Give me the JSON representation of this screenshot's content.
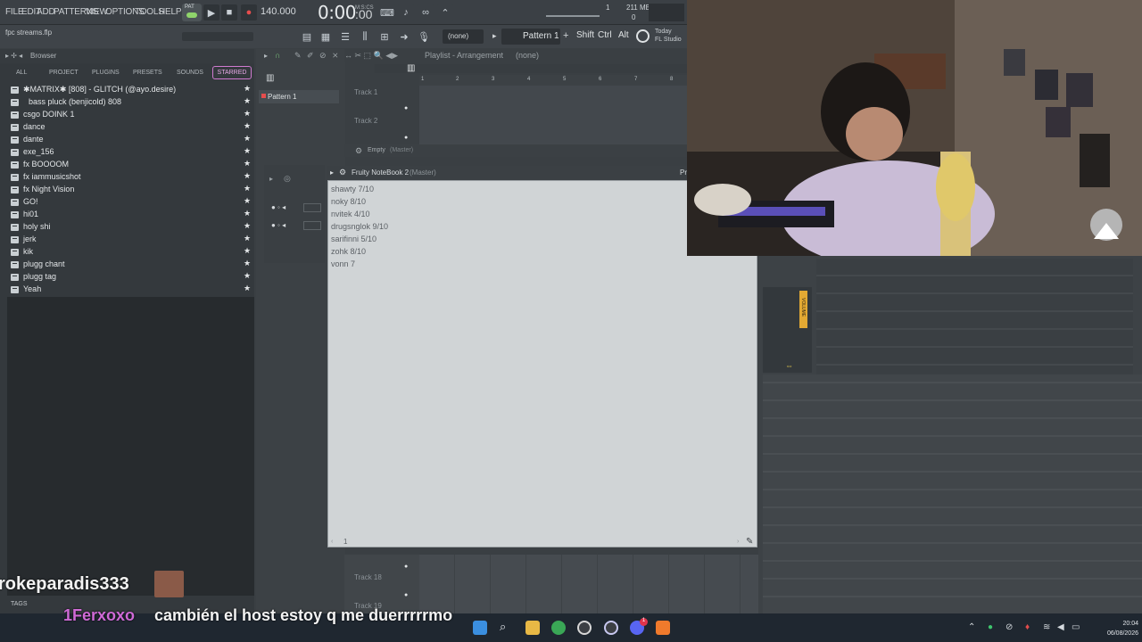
{
  "menu": [
    "FILE",
    "EDIT",
    "ADD",
    "PATTERNS",
    "VIEW",
    "OPTIONS",
    "TOOLS",
    "HELP"
  ],
  "transport": {
    "pat_label": "PAT",
    "tempo": "140.000",
    "time": "0:00",
    "time_small": ":00",
    "ms_label": "M:S:CS",
    "cpu_top": "211 MB",
    "cpu_bottom": "0",
    "cpu_num": "1"
  },
  "toolbar2": {
    "filename": "fpc streams.flp",
    "none": "(none)",
    "pattern": "Pattern 1",
    "shift": "Shift",
    "ctrl": "Ctrl",
    "alt": "Alt",
    "today_line1": "Today",
    "today_line2": "FL Studio"
  },
  "browser": {
    "title": "Browser",
    "tabs": [
      "ALL",
      "PROJECT",
      "PLUGINS",
      "PRESETS",
      "SOUNDS"
    ],
    "starred": "STARRED",
    "items": [
      "✱MATRIX✱ [808] - GLITCH (@ayo.desire)",
      "bass pluck (benjicold) 808",
      "csgo DOINK 1",
      "dance",
      "dante",
      "exe_156",
      "fx BOOOOM",
      "fx iammusicshot",
      "fx Night Vision",
      "GO!",
      "hi01",
      "holy shi",
      "jerk",
      "kik",
      "plugg chant",
      "plugg tag",
      "Yeah"
    ],
    "tags": "TAGS"
  },
  "pattern_panel": {
    "item": "Pattern 1"
  },
  "playlist": {
    "title": "Playlist - Arrangement",
    "title_suffix": "(none)",
    "ruler": [
      "1",
      "2",
      "3",
      "4",
      "5",
      "6",
      "7",
      "8"
    ],
    "tracks": [
      "Track 1",
      "Track 2",
      "Track 18",
      "Track 19"
    ],
    "empty": "Empty",
    "empty_suffix": "(Master)"
  },
  "notebook": {
    "title": "Fruity NoteBook 2",
    "title_suffix": "(Master)",
    "lines": "shawty 7/10\nnoky 8/10\nnvitek 4/10\ndrugsnglok 9/10\nsarifinni 5/10\nzohk 8/10\nvonn 7",
    "page": "1",
    "right_label": "Pr"
  },
  "mixer": {
    "volume_label": "VOLUME"
  },
  "chat": {
    "user1": "rokeparadis333",
    "user2": "1Ferxoxo",
    "message": "cambién el host estoy q me duerrrrrmo"
  },
  "taskbar": {
    "time": "20:04",
    "date": "06/08/2026",
    "badge": "1"
  },
  "colors": {
    "accent_starred": "#d07ad0",
    "volume": "#e3a933",
    "record": "#e64d4d",
    "chat_user2": "#cf6ad6"
  }
}
